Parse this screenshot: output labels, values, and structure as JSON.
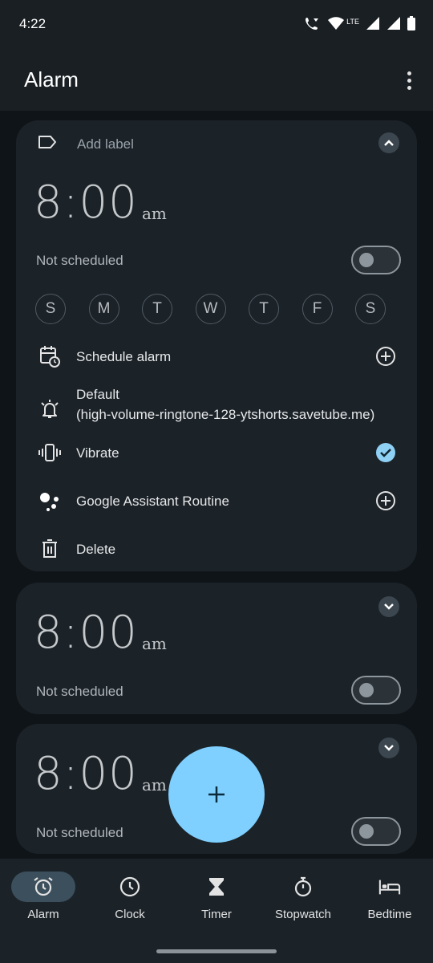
{
  "status_bar": {
    "time": "4:22",
    "network": "LTE"
  },
  "app_bar": {
    "title": "Alarm"
  },
  "alarms": [
    {
      "label_placeholder": "Add label",
      "time": "8:00",
      "ampm": "am",
      "status": "Not scheduled",
      "enabled": false,
      "expanded": true,
      "days": [
        "S",
        "M",
        "T",
        "W",
        "T",
        "F",
        "S"
      ],
      "schedule_label": "Schedule alarm",
      "ringtone_name": "Default",
      "ringtone_file": "(high-volume-ringtone-128-ytshorts.savetube.me)",
      "vibrate_label": "Vibrate",
      "vibrate_checked": true,
      "assistant_label": "Google Assistant Routine",
      "delete_label": "Delete"
    },
    {
      "time": "8:00",
      "ampm": "am",
      "status": "Not scheduled",
      "enabled": false,
      "expanded": false
    },
    {
      "time": "8:00",
      "ampm": "am",
      "status": "Not scheduled",
      "enabled": false,
      "expanded": false
    }
  ],
  "fab": {
    "icon": "plus-icon"
  },
  "nav": {
    "items": [
      {
        "label": "Alarm",
        "icon": "alarm-icon",
        "active": true
      },
      {
        "label": "Clock",
        "icon": "clock-icon",
        "active": false
      },
      {
        "label": "Timer",
        "icon": "hourglass-icon",
        "active": false
      },
      {
        "label": "Stopwatch",
        "icon": "stopwatch-icon",
        "active": false
      },
      {
        "label": "Bedtime",
        "icon": "bed-icon",
        "active": false
      }
    ]
  },
  "colors": {
    "background": "#0f1418",
    "card": "#1b2228",
    "accent": "#7fcfff",
    "check": "#8fd0f5"
  }
}
